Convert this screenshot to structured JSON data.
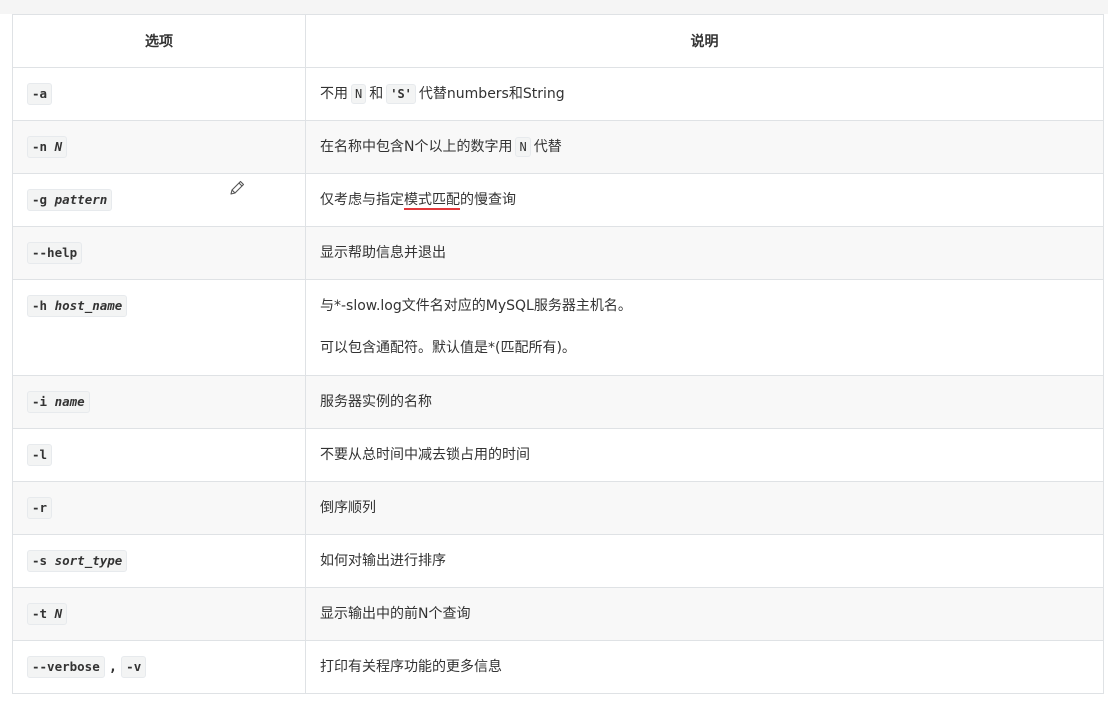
{
  "header": {
    "col_option": "选项",
    "col_description": "说明"
  },
  "rows": [
    {
      "option": "-a",
      "desc_parts": [
        "不用",
        "N",
        "和",
        "'S'",
        "代替numbers和String"
      ]
    },
    {
      "option": "-n",
      "arg": "N",
      "desc_parts": [
        "在名称中包含N个以上的数字用",
        "N",
        "代替"
      ]
    },
    {
      "option": "-g",
      "arg": "pattern",
      "desc_parts": [
        "仅考虑与指定",
        "模式匹配",
        "的慢查询"
      ]
    },
    {
      "option": "--help",
      "desc": "显示帮助信息并退出"
    },
    {
      "option": "-h",
      "arg": "host_name",
      "desc_line1": "与*-slow.log文件名对应的MySQL服务器主机名。",
      "desc_line2": "可以包含通配符。默认值是*(匹配所有)。"
    },
    {
      "option": "-i",
      "arg": "name",
      "desc": "服务器实例的名称"
    },
    {
      "option": "-l",
      "desc": "不要从总时间中减去锁占用的时间"
    },
    {
      "option": "-r",
      "desc": "倒序顺列"
    },
    {
      "option": "-s",
      "arg": "sort_type",
      "desc": "如何对输出进行排序"
    },
    {
      "option": "-t",
      "arg": "N",
      "desc": "显示输出中的前N个查询"
    },
    {
      "option": "--verbose",
      "separator": ",",
      "option_alt": "-v",
      "desc": "打印有关程序功能的更多信息"
    }
  ],
  "icons": {
    "edit": "pencil-icon"
  },
  "colors": {
    "border": "#dfe2e5",
    "stripe": "#f8f8f8",
    "code_bg": "#f3f4f4",
    "spellcheck_underline": "#e0383b"
  }
}
